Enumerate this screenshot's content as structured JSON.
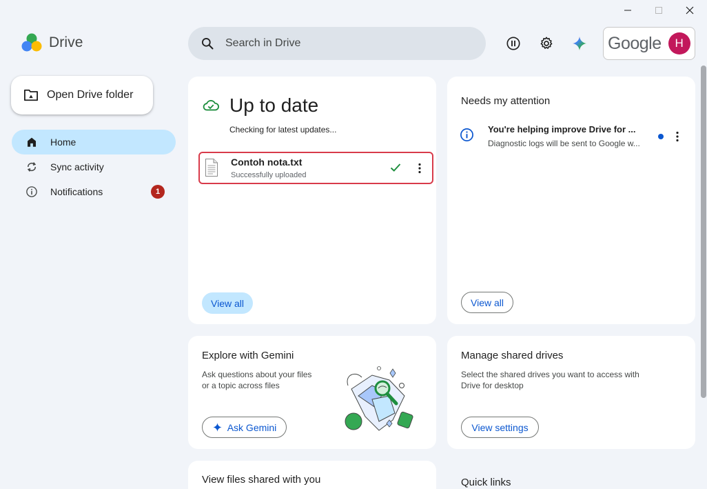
{
  "app": {
    "name": "Drive"
  },
  "search": {
    "placeholder": "Search in Drive"
  },
  "account": {
    "brand": "Google",
    "avatar_initial": "H",
    "avatar_color": "#c2185b"
  },
  "sidebar": {
    "open_folder_label": "Open Drive folder",
    "items": [
      {
        "label": "Home",
        "icon": "home-icon",
        "active": true
      },
      {
        "label": "Sync activity",
        "icon": "sync-icon",
        "active": false
      },
      {
        "label": "Notifications",
        "icon": "info-icon",
        "active": false,
        "badge": "1"
      }
    ]
  },
  "status_card": {
    "title": "Up to date",
    "subtitle": "Checking for latest updates...",
    "file": {
      "name": "Contoh nota.txt",
      "status": "Successfully uploaded"
    },
    "view_all_label": "View all"
  },
  "attention_card": {
    "title": "Needs my attention",
    "item": {
      "title": "You're helping improve Drive for ...",
      "desc": "Diagnostic logs will be sent to Google w..."
    },
    "view_all_label": "View all"
  },
  "gemini_card": {
    "title": "Explore with Gemini",
    "desc_line1": "Ask questions about your files",
    "desc_line2": "or a topic across files",
    "button_label": "Ask Gemini"
  },
  "shared_drives_card": {
    "title": "Manage shared drives",
    "desc_line1": "Select the shared drives you want to access with",
    "desc_line2": "Drive for desktop",
    "button_label": "View settings"
  },
  "shared_files_card": {
    "title": "View files shared with you"
  },
  "quick_links": {
    "title": "Quick links"
  },
  "colors": {
    "accent": "#0b57d0",
    "active_nav": "#c2e7ff",
    "badge": "#b3261e",
    "success": "#1e8e3e",
    "highlight": "#d83a4a"
  }
}
